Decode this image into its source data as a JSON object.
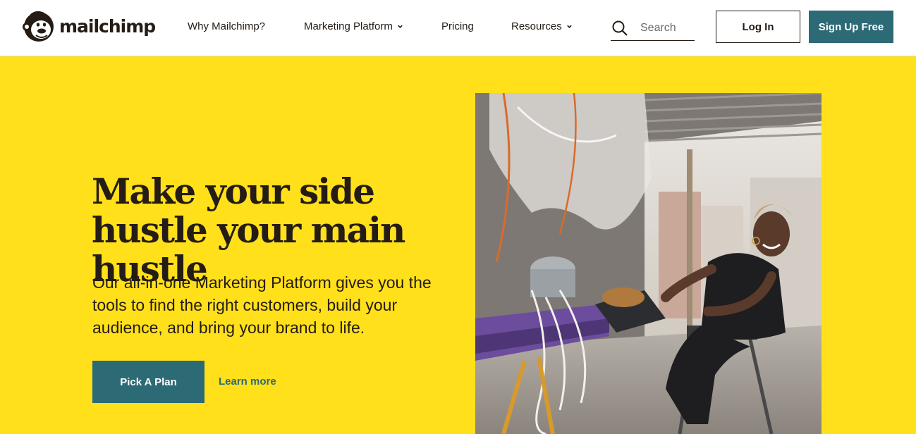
{
  "brand": {
    "name": "mailchimp",
    "logo_icon": "freddie-monkey-icon"
  },
  "nav": {
    "items": [
      {
        "label": "Why Mailchimp?",
        "has_dropdown": false
      },
      {
        "label": "Marketing Platform",
        "has_dropdown": true
      },
      {
        "label": "Pricing",
        "has_dropdown": false
      },
      {
        "label": "Resources",
        "has_dropdown": true
      }
    ]
  },
  "search": {
    "placeholder": "Search",
    "icon": "search-icon"
  },
  "auth": {
    "login_label": "Log In",
    "signup_label": "Sign Up Free"
  },
  "hero": {
    "headline": "Make your side hustle your main hustle",
    "subtext": "Our all-in-one Marketing Platform gives you the tools to find the right customers, build your audience, and bring your brand to life.",
    "primary_cta": "Pick A Plan",
    "secondary_cta": "Learn more"
  },
  "colors": {
    "hero_background": "#ffe01b",
    "accent_teal": "#2c6a75",
    "text_dark": "#241c15"
  }
}
